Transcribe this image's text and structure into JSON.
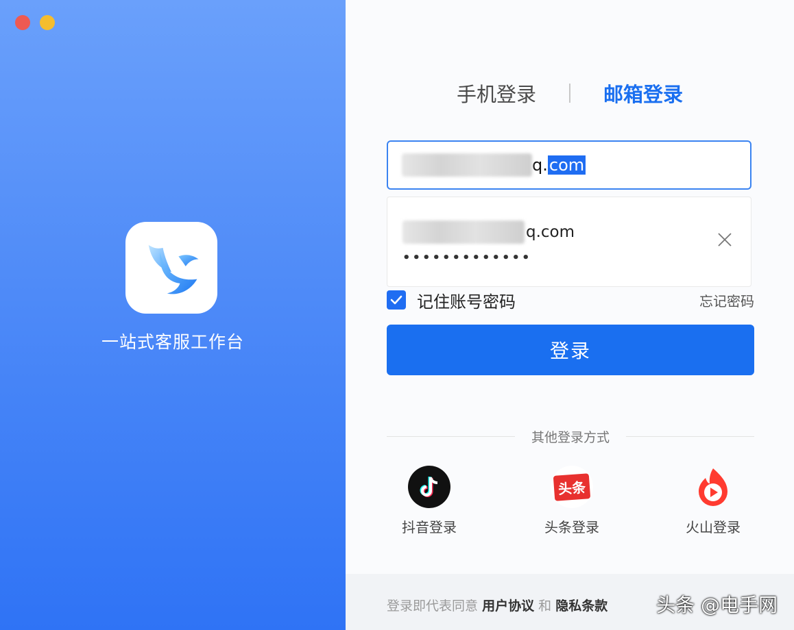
{
  "window": {
    "controls": [
      "close",
      "minimize"
    ]
  },
  "brand": {
    "title": "一站式客服工作台",
    "icon": "bird-logo-icon"
  },
  "tabs": [
    {
      "label": "手机登录",
      "active": false
    },
    {
      "label": "邮箱登录",
      "active": true
    }
  ],
  "email_input": {
    "value_suffix_plain": "q.",
    "value_selected": "com"
  },
  "saved_account": {
    "email_suffix": "q.com",
    "password_mask": "•••••••••••••"
  },
  "remember": {
    "label": "记住账号密码",
    "checked": true
  },
  "forgot_password": "忘记密码",
  "login_button": "登录",
  "other_methods": {
    "label": "其他登录方式",
    "items": [
      {
        "label": "抖音登录",
        "icon": "douyin-icon"
      },
      {
        "label": "头条登录",
        "icon": "toutiao-icon",
        "icon_text": "头条"
      },
      {
        "label": "火山登录",
        "icon": "huoshan-icon"
      }
    ]
  },
  "footer": {
    "prefix": "登录即代表同意",
    "terms": "用户协议",
    "and": "和",
    "privacy": "隐私条款"
  },
  "watermark": "头条 @电手网",
  "colors": {
    "accent": "#1a6ff0",
    "panel_top": "#6aa0fb",
    "panel_bottom": "#2f73f5"
  }
}
